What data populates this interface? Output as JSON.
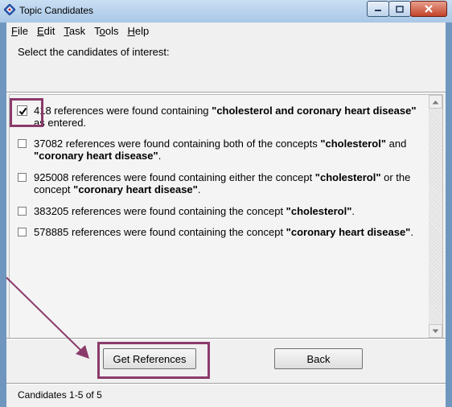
{
  "window": {
    "title": "Topic Candidates"
  },
  "menu": [
    {
      "label_pre": "",
      "label_ul": "F",
      "label_post": "ile"
    },
    {
      "label_pre": "",
      "label_ul": "E",
      "label_post": "dit"
    },
    {
      "label_pre": "",
      "label_ul": "T",
      "label_post": "ask"
    },
    {
      "label_pre": "T",
      "label_ul": "o",
      "label_post": "ols"
    },
    {
      "label_pre": "",
      "label_ul": "H",
      "label_post": "elp"
    }
  ],
  "prompt": "Select the candidates of interest:",
  "candidates": [
    {
      "checked": true,
      "parts": [
        {
          "t": "418 references were found containing ",
          "b": false
        },
        {
          "t": "\"cholesterol and coronary heart disease\"",
          "b": true
        },
        {
          "t": " as entered.",
          "b": false
        }
      ]
    },
    {
      "checked": false,
      "parts": [
        {
          "t": "37082 references were found containing both of the concepts ",
          "b": false
        },
        {
          "t": "\"cholesterol\"",
          "b": true
        },
        {
          "t": " and ",
          "b": false
        },
        {
          "t": "\"coronary heart disease\"",
          "b": true
        },
        {
          "t": ".",
          "b": false
        }
      ]
    },
    {
      "checked": false,
      "parts": [
        {
          "t": "925008 references were found containing either the concept ",
          "b": false
        },
        {
          "t": "\"cholesterol\"",
          "b": true
        },
        {
          "t": " or the concept ",
          "b": false
        },
        {
          "t": "\"coronary heart disease\"",
          "b": true
        },
        {
          "t": ".",
          "b": false
        }
      ]
    },
    {
      "checked": false,
      "parts": [
        {
          "t": "383205 references were found containing the concept ",
          "b": false
        },
        {
          "t": "\"cholesterol\"",
          "b": true
        },
        {
          "t": ".",
          "b": false
        }
      ]
    },
    {
      "checked": false,
      "parts": [
        {
          "t": "578885 references were found containing the concept ",
          "b": false
        },
        {
          "t": "\"coronary heart disease\"",
          "b": true
        },
        {
          "t": ".",
          "b": false
        }
      ]
    }
  ],
  "buttons": {
    "get_references": "Get References",
    "back": "Back"
  },
  "status": "Candidates 1-5 of 5",
  "colors": {
    "highlight": "#8b3b6b",
    "title_gradient_top": "#c9dff3",
    "close_button": "#c4432b"
  }
}
